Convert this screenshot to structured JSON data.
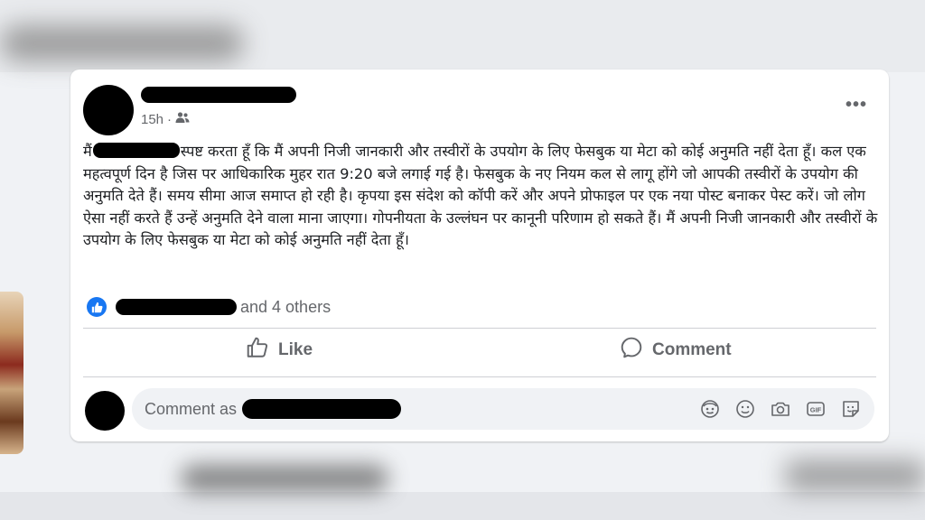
{
  "post": {
    "time": "15h",
    "separator": "·",
    "audience_icon": "friends-icon",
    "more_label": "•••",
    "text_before": "मैं",
    "text_after": "स्पष्ट करता हूँ कि मैं अपनी निजी जानकारी और तस्वीरों के उपयोग के लिए फेसबुक या मेटा को कोई अनुमति नहीं देता हूँ। कल एक महत्वपूर्ण दिन है जिस पर आधिकारिक मुहर रात 9:20 बजे लगाई गई है। फेसबुक के नए नियम कल से लागू होंगे जो आपकी तस्वीरों के उपयोग की अनुमति देते हैं। समय सीमा आज समाप्त हो रही है। कृपया इस संदेश को कॉपी करें और अपने प्रोफाइल पर एक नया पोस्ट बनाकर पेस्ट करें। जो लोग ऐसा नहीं करते हैं उन्हें अनुमति देने वाला माना जाएगा। गोपनीयता के उल्लंघन पर कानूनी परिणाम हो सकते हैं। मैं अपनी निजी जानकारी और तस्वीरों के उपयोग के लिए फेसबुक या मेटा को कोई अनुमति नहीं देता हूँ।"
  },
  "reactions": {
    "icon": "like-reaction-icon",
    "others_label": "and 4 others"
  },
  "actions": {
    "like_label": "Like",
    "comment_label": "Comment"
  },
  "comment_box": {
    "placeholder": "Comment as",
    "icons": [
      "avatar-sticker-icon",
      "emoji-icon",
      "camera-icon",
      "gif-icon",
      "sticker-icon"
    ]
  },
  "colors": {
    "brand_blue": "#1877f2",
    "secondary_text": "#65676b",
    "background": "#f0f2f5"
  }
}
